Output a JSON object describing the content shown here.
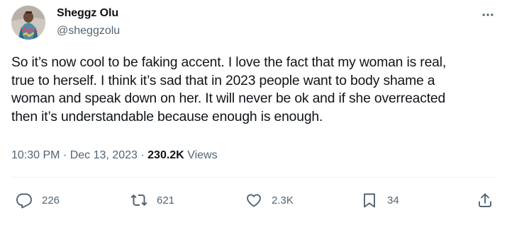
{
  "author": {
    "name": "Sheggz Olu",
    "handle": "@sheggzolu"
  },
  "tweet": {
    "text_lines": [
      "So it’s now cool to be faking accent. I love the fact that my woman is real,",
      "true to herself. I think it’s sad that in 2023 people want to body shame a",
      "woman and speak down on her. It will never be ok and if she overreacted",
      "then it’s understandable because enough is enough."
    ],
    "time": "10:30 PM",
    "separator": "·",
    "date": "Dec 13, 2023",
    "views_count": "230.2K",
    "views_label": "Views"
  },
  "actions": {
    "replies": "226",
    "retweets": "621",
    "likes": "2.3K",
    "bookmarks": "34"
  },
  "colors": {
    "text_primary": "#0f1419",
    "text_secondary": "#536471",
    "divider": "#eff3f4"
  },
  "icons": [
    "more-icon",
    "reply-icon",
    "retweet-icon",
    "like-icon",
    "bookmark-icon",
    "share-icon"
  ]
}
